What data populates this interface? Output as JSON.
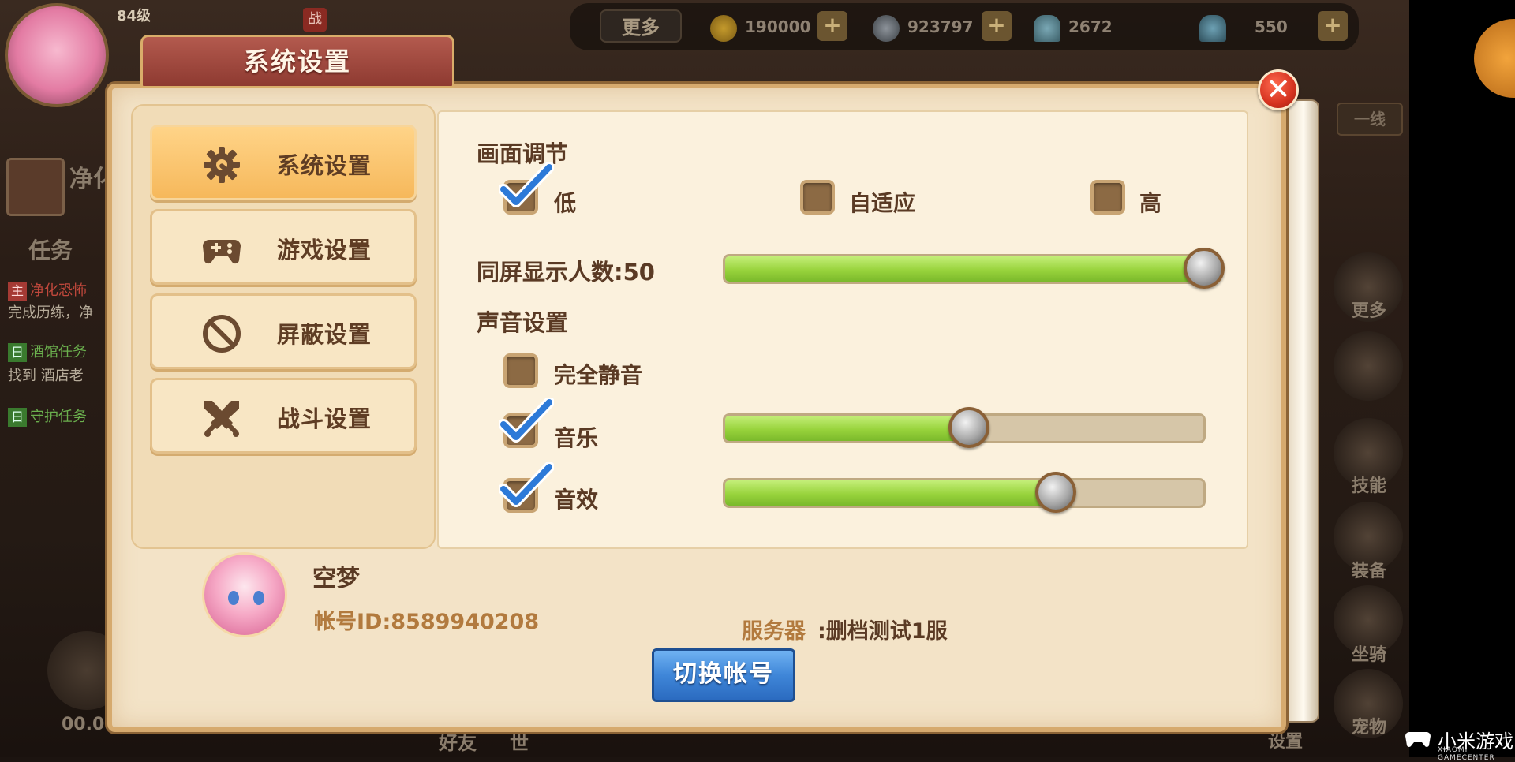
{
  "hud": {
    "level": "84级",
    "battle_tag": "战",
    "more_button": "更多",
    "currencies": [
      {
        "name": "gold-coin",
        "value": "190000"
      },
      {
        "name": "silver-coin",
        "value": "923797"
      },
      {
        "name": "shell-gem",
        "value": "2672"
      },
      {
        "name": "blue-gem",
        "value": "550"
      }
    ],
    "plus_label": "+",
    "left_panel": {
      "hero_name_partial": "净化",
      "quest_tab": "任务",
      "quest_lines": [
        {
          "tag": "主",
          "text": "净化恐怖"
        },
        {
          "tag": "",
          "text": "完成历练，净"
        },
        {
          "tag": "日",
          "text": "酒馆任务"
        },
        {
          "tag": "",
          "text": "找到 酒店老"
        },
        {
          "tag": "日",
          "text": "守护任务"
        }
      ],
      "bottom_time": "00.0",
      "bottom_tab": "好友",
      "bottom_tab2": "世"
    },
    "right_panel": {
      "line_button": "一线",
      "menu": [
        "更多",
        "技能",
        "装备",
        "坐骑",
        "宠物"
      ],
      "bottom_right": "设置"
    }
  },
  "dialog": {
    "title": "系统设置",
    "close_symbol": "✕",
    "tabs": [
      {
        "label": "系统设置",
        "icon": "gear-wrench-icon",
        "active": true
      },
      {
        "label": "游戏设置",
        "icon": "gamepad-icon",
        "active": false
      },
      {
        "label": "屏蔽设置",
        "icon": "block-icon",
        "active": false
      },
      {
        "label": "战斗设置",
        "icon": "crossed-swords-icon",
        "active": false
      }
    ],
    "graphics": {
      "title": "画面调节",
      "options": [
        {
          "label": "低",
          "checked": true
        },
        {
          "label": "自适应",
          "checked": false
        },
        {
          "label": "高",
          "checked": false
        }
      ]
    },
    "players_on_screen": {
      "label": "同屏显示人数:50",
      "value": 50,
      "fill": 1.0
    },
    "sound": {
      "title": "声音设置",
      "mute": {
        "label": "完全静音",
        "checked": false
      },
      "music": {
        "label": "音乐",
        "checked": true,
        "level": 0.51
      },
      "effects": {
        "label": "音效",
        "checked": true,
        "level": 0.69
      }
    },
    "account": {
      "name": "空梦",
      "id_text": "帐号ID:8589940208",
      "server_label": "服务器",
      "server_value": ":删档测试1服",
      "switch_button": "切换帐号"
    }
  },
  "watermark": {
    "main": "小米游戏",
    "sub": "XIAOMI GAMECENTER"
  },
  "colors": {
    "accent_orange": "#f6b85b",
    "slider_green": "#98d33c",
    "close_red": "#d5321f",
    "button_blue": "#3f86d8",
    "text_brown": "#5a3a24"
  }
}
